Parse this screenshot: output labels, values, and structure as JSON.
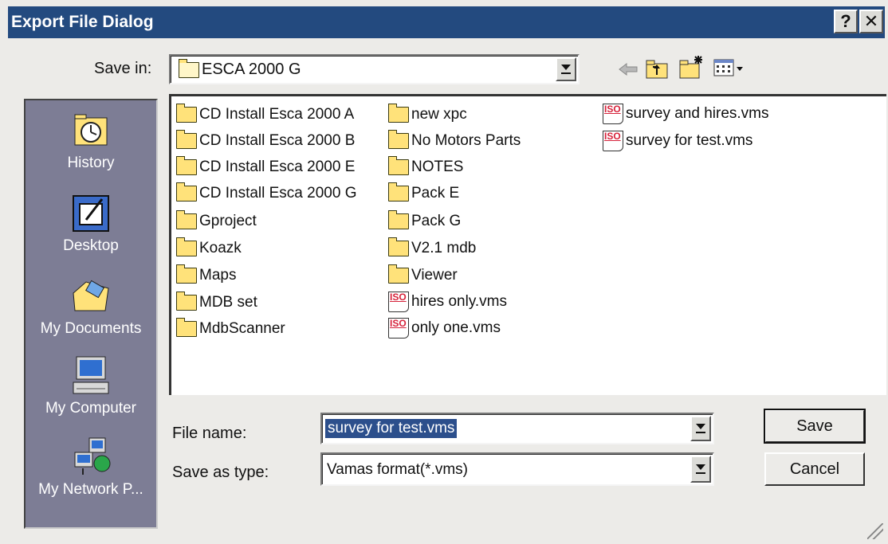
{
  "window": {
    "title": "Export File Dialog",
    "help_label": "?",
    "close_label": "✕"
  },
  "save_in": {
    "label": "Save in:",
    "value": "ESCA 2000 G"
  },
  "places": [
    {
      "label": "History",
      "icon": "history-icon"
    },
    {
      "label": "Desktop",
      "icon": "desktop-icon"
    },
    {
      "label": "My Documents",
      "icon": "my-documents-icon"
    },
    {
      "label": "My Computer",
      "icon": "my-computer-icon"
    },
    {
      "label": "My Network P...",
      "icon": "network-places-icon"
    }
  ],
  "files": {
    "col1": [
      "CD Install Esca 2000 A",
      "CD Install Esca 2000 B",
      "CD Install Esca 2000 E",
      "CD Install Esca 2000 G",
      "Gproject",
      "Koazk",
      "Maps",
      "MDB set",
      "MdbScanner"
    ],
    "col2_folders": [
      "new xpc",
      "No Motors Parts",
      "NOTES",
      "Pack E",
      "Pack G",
      "V2.1 mdb",
      "Viewer"
    ],
    "col2_files": [
      "hires only.vms",
      "only one.vms"
    ],
    "col3_files": [
      "survey and hires.vms",
      "survey for test.vms"
    ],
    "file_icon_text": "ISO"
  },
  "form": {
    "file_name_label": "File name:",
    "file_name_value": "survey for test.vms",
    "type_label": "Save as type:",
    "type_value": "Vamas format(*.vms)"
  },
  "buttons": {
    "save": "Save",
    "cancel": "Cancel"
  },
  "colors": {
    "titlebar": "#234a7f",
    "places_bg": "#7d7d95",
    "selection": "#2c4f8c",
    "folder": "#ffe27a"
  }
}
